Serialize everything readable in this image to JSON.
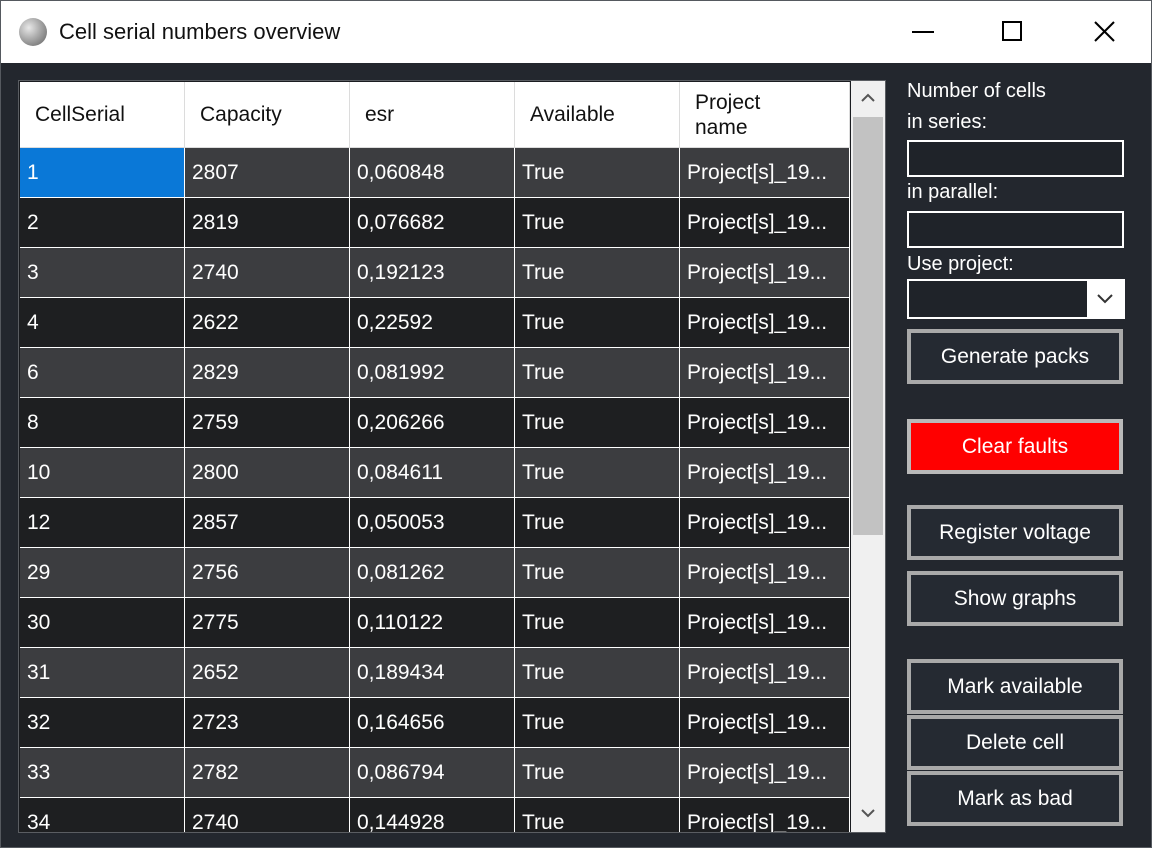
{
  "window": {
    "title": "Cell serial numbers overview",
    "app_icon": "sphere-icon",
    "controls": [
      "minimize-icon",
      "maximize-icon",
      "close-icon"
    ]
  },
  "table": {
    "columns": [
      "CellSerial",
      "Capacity",
      "esr",
      "Available",
      "Project\nname"
    ],
    "rows": [
      [
        "1",
        "2807",
        "0,060848",
        "True",
        "Project[s]_19..."
      ],
      [
        "2",
        "2819",
        "0,076682",
        "True",
        "Project[s]_19..."
      ],
      [
        "3",
        "2740",
        "0,192123",
        "True",
        "Project[s]_19..."
      ],
      [
        "4",
        "2622",
        "0,22592",
        "True",
        "Project[s]_19..."
      ],
      [
        "6",
        "2829",
        "0,081992",
        "True",
        "Project[s]_19..."
      ],
      [
        "8",
        "2759",
        "0,206266",
        "True",
        "Project[s]_19..."
      ],
      [
        "10",
        "2800",
        "0,084611",
        "True",
        "Project[s]_19..."
      ],
      [
        "12",
        "2857",
        "0,050053",
        "True",
        "Project[s]_19..."
      ],
      [
        "29",
        "2756",
        "0,081262",
        "True",
        "Project[s]_19..."
      ],
      [
        "30",
        "2775",
        "0,110122",
        "True",
        "Project[s]_19..."
      ],
      [
        "31",
        "2652",
        "0,189434",
        "True",
        "Project[s]_19..."
      ],
      [
        "32",
        "2723",
        "0,164656",
        "True",
        "Project[s]_19..."
      ],
      [
        "33",
        "2782",
        "0,086794",
        "True",
        "Project[s]_19..."
      ],
      [
        "34",
        "2740",
        "0,144928",
        "True",
        "Project[s]_19..."
      ]
    ],
    "selected_row": 0
  },
  "side": {
    "cells_label": "Number of cells",
    "series_label": "in series:",
    "series_value": "",
    "parallel_label": "in parallel:",
    "parallel_value": "",
    "project_label": "Use project:",
    "project_value": "",
    "generate_button": "Generate packs",
    "clear_faults_button": "Clear faults",
    "register_voltage_button": "Register voltage",
    "show_graphs_button": "Show graphs",
    "mark_available_button": "Mark available",
    "delete_cell_button": "Delete cell",
    "mark_bad_button": "Mark as bad"
  },
  "colors": {
    "background": "#23272e",
    "selection": "#0a78d7",
    "danger": "#ff0000",
    "row_light": "#3c3d40",
    "row_dark": "#1e1f21"
  }
}
